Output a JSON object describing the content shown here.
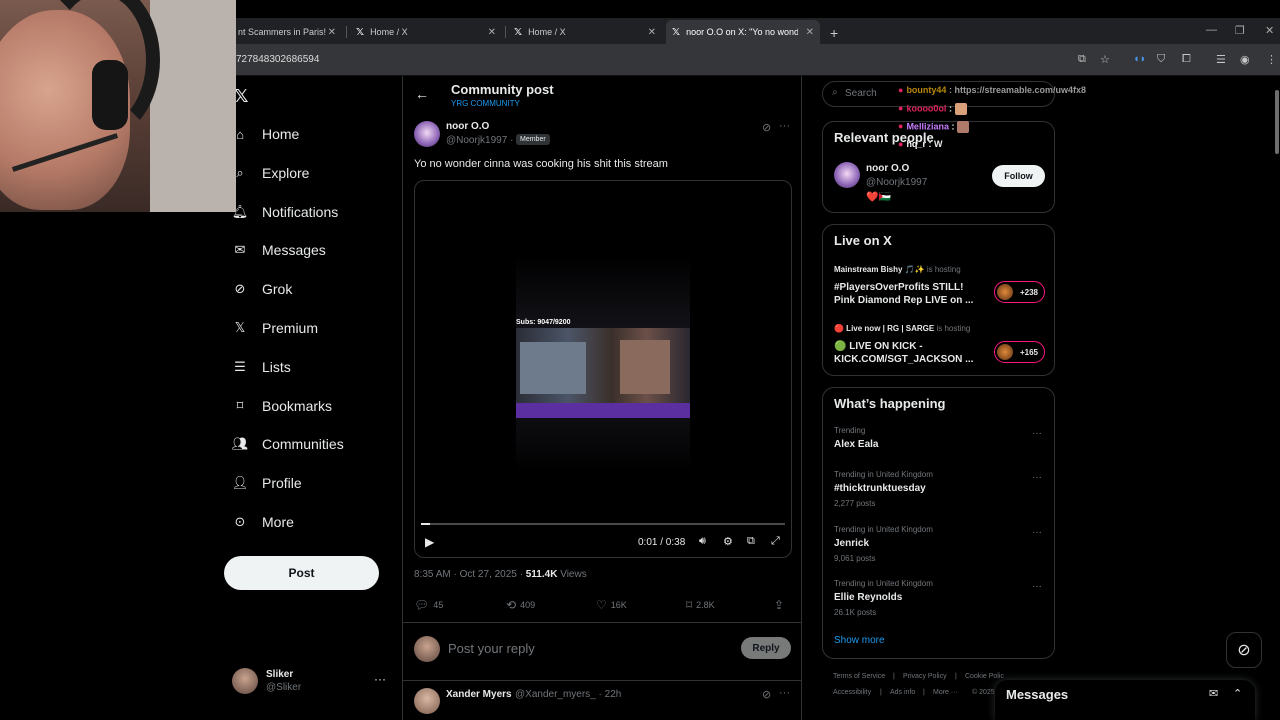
{
  "browser": {
    "tabs": [
      {
        "title": "nt Scammers in Paris! *ar",
        "active": false
      },
      {
        "title": "Home / X",
        "active": false
      },
      {
        "title": "Home / X",
        "active": false
      },
      {
        "title": "noor O.O on X: \"Yo no wonder",
        "active": true
      }
    ],
    "new_tab": "+",
    "url": "727848302686594"
  },
  "nav": {
    "items": [
      {
        "label": "Home",
        "icon": "home-icon"
      },
      {
        "label": "Explore",
        "icon": "search-icon"
      },
      {
        "label": "Notifications",
        "icon": "bell-icon"
      },
      {
        "label": "Messages",
        "icon": "envelope-icon"
      },
      {
        "label": "Grok",
        "icon": "grok-icon"
      },
      {
        "label": "Premium",
        "icon": "x-icon"
      },
      {
        "label": "Lists",
        "icon": "list-icon"
      },
      {
        "label": "Bookmarks",
        "icon": "bookmark-icon"
      },
      {
        "label": "Communities",
        "icon": "people-icon"
      },
      {
        "label": "Profile",
        "icon": "person-icon"
      },
      {
        "label": "More",
        "icon": "more-circle-icon"
      }
    ],
    "post_label": "Post",
    "account": {
      "name": "Sliker",
      "handle": "@Sliker"
    }
  },
  "header": {
    "title": "Community post",
    "subtitle": "YRG COMMUNITY"
  },
  "post": {
    "author": "noor O.O",
    "handle": "@Noorjk1997",
    "separator": "·",
    "badge": "Member",
    "text": "Yo no wonder cinna was cooking his shit this stream",
    "video": {
      "overlay_text": "Subs: 9047/9200",
      "time": "0:01 / 0:38",
      "progress": 0.026
    },
    "meta": {
      "timestamp": "8:35 AM · Oct 27, 2025 ·",
      "views": "511.4K",
      "views_label": "Views"
    },
    "actions": {
      "replies": "45",
      "reposts": "409",
      "likes": "16K",
      "bookmarks": "2.8K"
    }
  },
  "reply": {
    "placeholder": "Post your reply",
    "button": "Reply"
  },
  "comment": {
    "author": "Xander Myers",
    "handle": "@Xander_myers_ · 22h"
  },
  "sidebar": {
    "search_placeholder": "Search",
    "relevant": {
      "title": "Relevant people",
      "name": "noor O.O",
      "handle": "@Noorjk1997",
      "emoji": "❤️🇵🇸",
      "follow": "Follow"
    },
    "live": {
      "title": "Live on X",
      "items": [
        {
          "host": "Mainstream Bishy 🎵✨",
          "hosting": "is hosting",
          "title": "#PlayersOverProfits STILL! Pink Diamond Rep LIVE on ...",
          "count": "+238"
        },
        {
          "host": "🔴 Live now | RG | SARGE",
          "hosting": "is hosting",
          "title": "🟢 LIVE ON KICK - KICK.COM/SGT_JACKSON ...",
          "count": "+165"
        }
      ]
    },
    "happening": {
      "title": "What’s happening",
      "trends": [
        {
          "label": "Trending",
          "name": "Alex Eala",
          "posts": ""
        },
        {
          "label": "Trending in United Kingdom",
          "name": "#thicktrunktuesday",
          "posts": "2,277 posts"
        },
        {
          "label": "Trending in United Kingdom",
          "name": "Jenrick",
          "posts": "9,061 posts"
        },
        {
          "label": "Trending in United Kingdom",
          "name": "Ellie Reynolds",
          "posts": "26.1K posts"
        }
      ],
      "show_more": "Show more"
    },
    "footer": {
      "terms": "Terms of Service",
      "privacy": "Privacy Policy",
      "cookie": "Cookie Polic",
      "accessibility": "Accessibility",
      "ads": "Ads info",
      "more": "More ···",
      "copyright": "© 2025"
    }
  },
  "chat": [
    {
      "user": "bounty44",
      "message": ": https://streamable.com/uw4fx8",
      "color": "#b8860b"
    },
    {
      "user": "koooo0ol",
      "message": ":",
      "color": "#e0245e"
    },
    {
      "user": "Melliziana",
      "message": ":",
      "color": "#c77dff"
    },
    {
      "user": "hq_r",
      "message": ": W",
      "color": "#ffffff"
    }
  ],
  "messages_dock": {
    "title": "Messages"
  }
}
